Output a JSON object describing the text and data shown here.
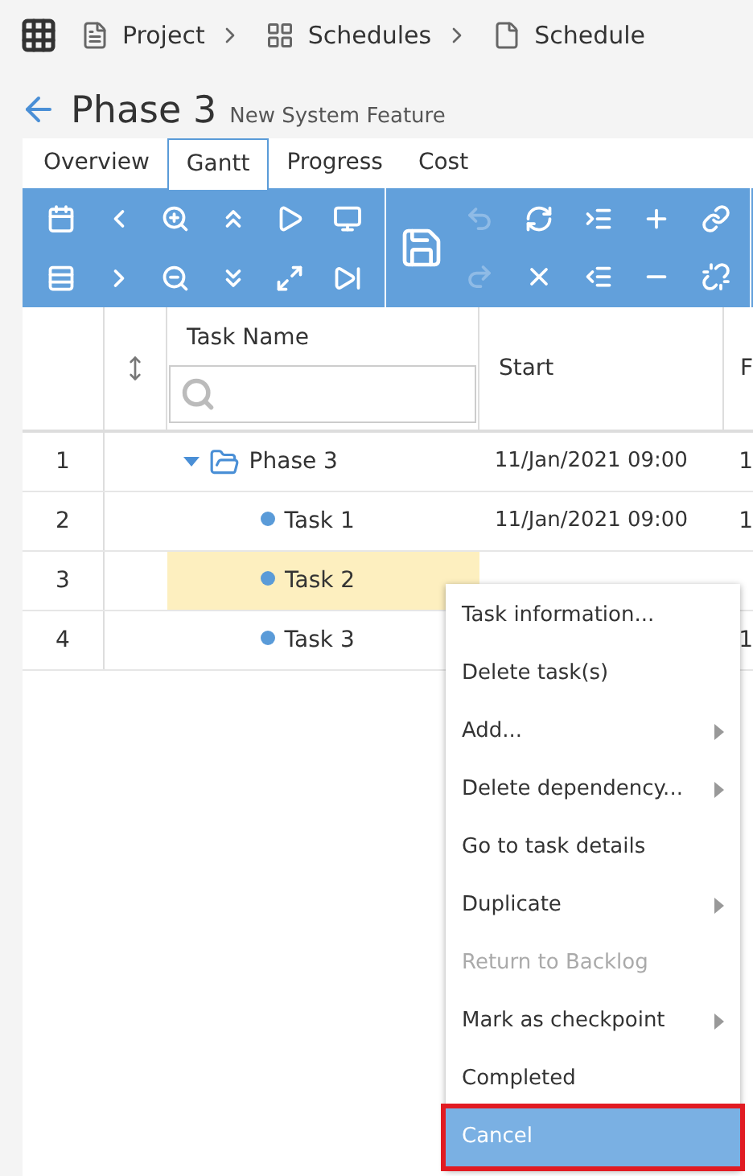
{
  "breadcrumb": [
    {
      "kind": "project",
      "label": "Project"
    },
    {
      "kind": "schedules",
      "label": "Schedules"
    },
    {
      "kind": "schedule",
      "label": "Schedule"
    }
  ],
  "header": {
    "title": "Phase 3",
    "subtitle": "New System Feature"
  },
  "tabs": [
    {
      "label": "Overview",
      "selected": false
    },
    {
      "label": "Gantt",
      "selected": true
    },
    {
      "label": "Progress",
      "selected": false
    },
    {
      "label": "Cost",
      "selected": false
    }
  ],
  "toolbar": {
    "groups": [
      {
        "items": [
          {
            "kind": "calendar",
            "disabled": false
          },
          {
            "kind": "prev",
            "disabled": false
          },
          {
            "kind": "zoom-in",
            "disabled": false
          },
          {
            "kind": "up",
            "disabled": false
          },
          {
            "kind": "play",
            "disabled": false
          },
          {
            "kind": "monitor",
            "disabled": false
          },
          {
            "kind": "rows",
            "disabled": false
          },
          {
            "kind": "next",
            "disabled": false
          },
          {
            "kind": "zoom-out",
            "disabled": false
          },
          {
            "kind": "down",
            "disabled": false
          },
          {
            "kind": "fit",
            "disabled": false
          },
          {
            "kind": "end",
            "disabled": false
          }
        ]
      },
      {
        "save": {
          "disabled": false
        },
        "items": [
          {
            "kind": "undo",
            "disabled": true
          },
          {
            "kind": "refresh",
            "disabled": false
          },
          {
            "kind": "indent",
            "disabled": false
          },
          {
            "kind": "add",
            "disabled": false
          },
          {
            "kind": "link",
            "disabled": false
          },
          {
            "kind": "redo",
            "disabled": true
          },
          {
            "kind": "delete",
            "disabled": false
          },
          {
            "kind": "outdent",
            "disabled": false
          },
          {
            "kind": "remove",
            "disabled": false
          },
          {
            "kind": "unlink",
            "disabled": false
          }
        ]
      }
    ]
  },
  "table": {
    "columns": [
      {
        "label": "Task Name"
      },
      {
        "label": "Start"
      },
      {
        "label": "F"
      }
    ],
    "rows": [
      {
        "number": "1",
        "kind": "summary",
        "expanded": true,
        "name": "Phase 3",
        "start": "11/Jan/2021 09:00",
        "column_3": "1",
        "selected": false
      },
      {
        "number": "2",
        "kind": "task",
        "name": "Task 1",
        "start": "11/Jan/2021 09:00",
        "column_3": "1",
        "selected": false
      },
      {
        "number": "3",
        "kind": "task",
        "name": "Task 2",
        "selected": true
      },
      {
        "number": "4",
        "kind": "task",
        "name": "Task 3",
        "column_3": "1",
        "selected": false
      }
    ]
  },
  "context_menu": [
    {
      "label": "Task information...",
      "submenu": false,
      "disabled": false,
      "selected": false
    },
    {
      "label": "Delete task(s)",
      "submenu": false,
      "disabled": false,
      "selected": false
    },
    {
      "label": "Add...",
      "submenu": true,
      "disabled": false,
      "selected": false
    },
    {
      "label": "Delete dependency...",
      "submenu": true,
      "disabled": false,
      "selected": false
    },
    {
      "label": "Go to task details",
      "submenu": false,
      "disabled": false,
      "selected": false
    },
    {
      "label": "Duplicate",
      "submenu": true,
      "disabled": false,
      "selected": false
    },
    {
      "label": "Return to Backlog",
      "submenu": false,
      "disabled": true,
      "selected": false
    },
    {
      "label": "Mark as checkpoint",
      "submenu": true,
      "disabled": false,
      "selected": false
    },
    {
      "label": "Completed",
      "submenu": false,
      "disabled": false,
      "selected": false
    },
    {
      "label": "Cancel",
      "submenu": false,
      "disabled": false,
      "selected": true
    }
  ]
}
